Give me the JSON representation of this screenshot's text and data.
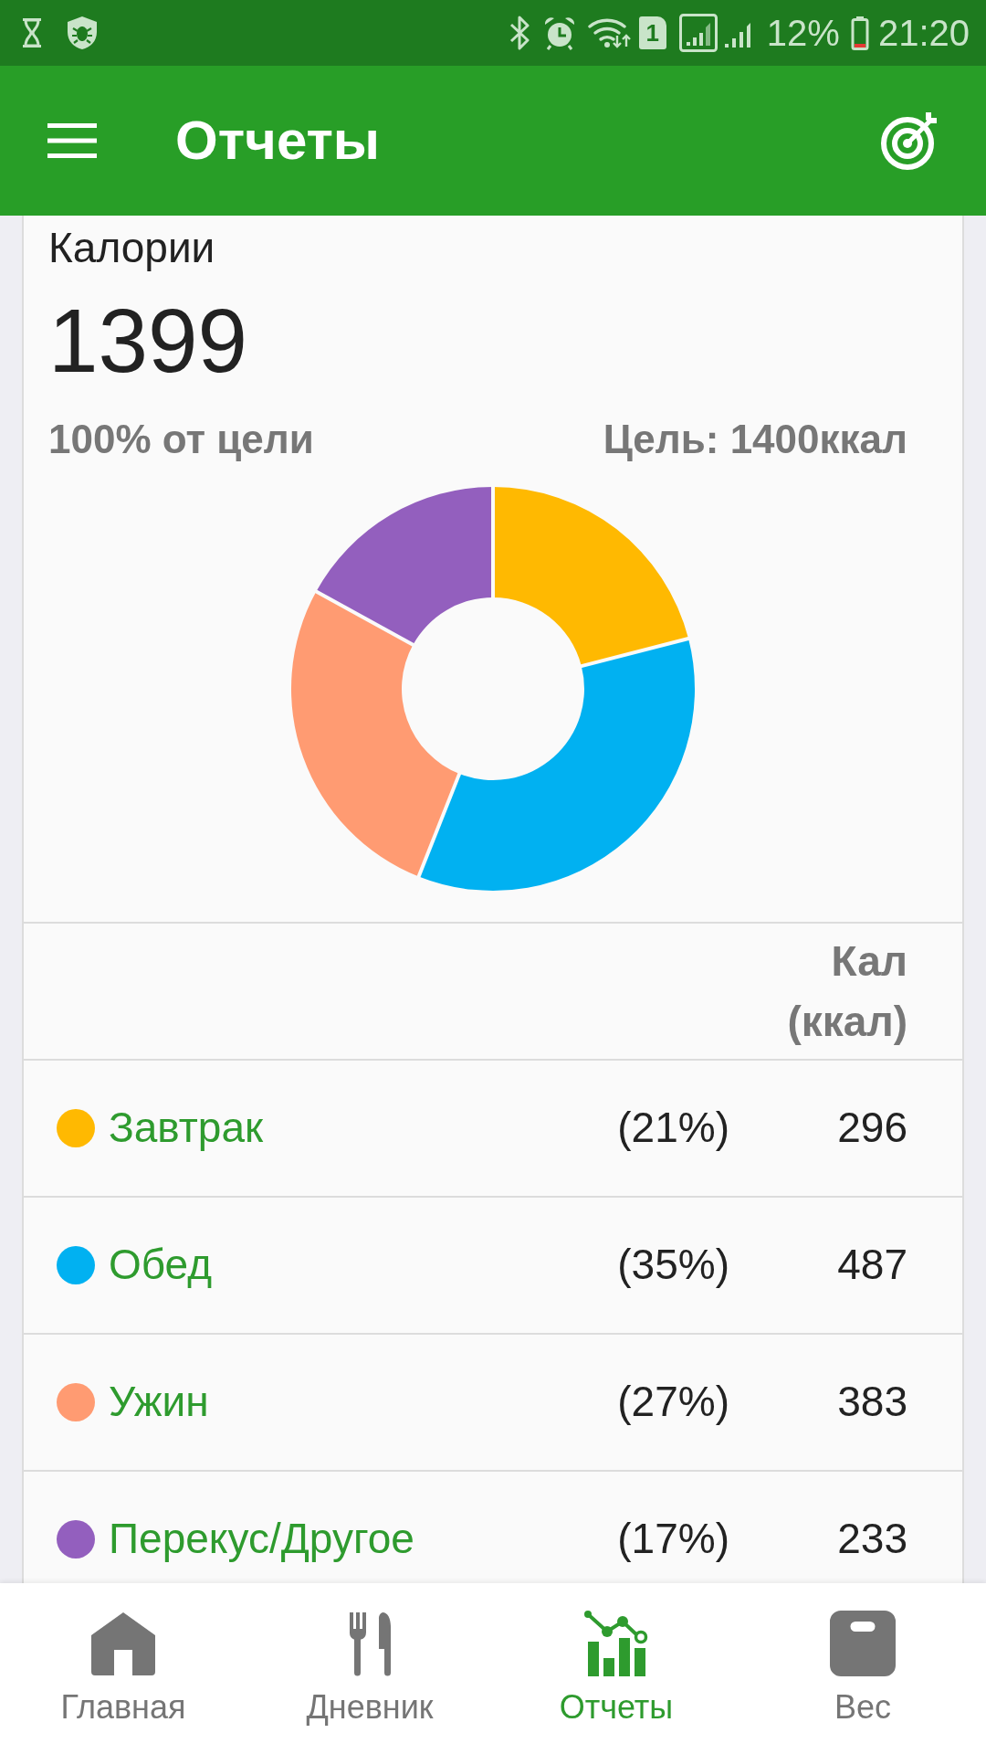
{
  "status_bar": {
    "sim_label": "1",
    "battery": "12%",
    "time": "21:20"
  },
  "app_bar": {
    "title": "Отчеты"
  },
  "summary": {
    "title": "Калории",
    "total": "1399",
    "goal_percent": "100% от цели",
    "goal": "Цель: 1400ккал",
    "chart_data": {
      "type": "donut",
      "values": [
        21,
        35,
        27,
        17
      ]
    }
  },
  "table": {
    "value_header": "Кал (ккал)",
    "rows": [
      {
        "name": "Завтрак",
        "color": "#ffb901",
        "percent": "(21%)",
        "calories": "296"
      },
      {
        "name": "Обед",
        "color": "#01b1f1",
        "percent": "(35%)",
        "calories": "487"
      },
      {
        "name": "Ужин",
        "color": "#ff9b72",
        "percent": "(27%)",
        "calories": "383"
      },
      {
        "name": "Перекус/Другое",
        "color": "#935fbe",
        "percent": "(17%)",
        "calories": "233"
      }
    ]
  },
  "bottom_nav": [
    {
      "label": "Главная",
      "selected": false
    },
    {
      "label": "Дневник",
      "selected": false
    },
    {
      "label": "Отчеты",
      "selected": true
    },
    {
      "label": "Вес",
      "selected": false
    }
  ]
}
